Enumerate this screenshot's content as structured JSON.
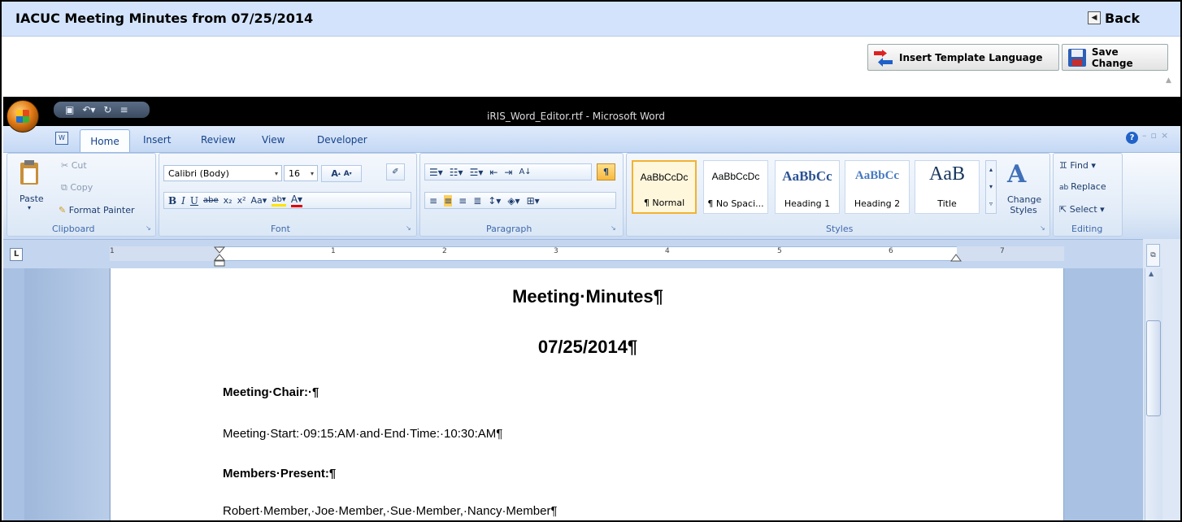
{
  "header": {
    "title": "IACUC Meeting Minutes from 07/25/2014",
    "back_label": "Back"
  },
  "toolbar": {
    "insert_template_label": "Insert Template Language",
    "save_label": "Save Change"
  },
  "word": {
    "window_title": "iRIS_Word_Editor.rtf - Microsoft Word",
    "tabs": [
      "Home",
      "Insert",
      "Review",
      "View",
      "Developer"
    ],
    "clipboard": {
      "paste": "Paste",
      "cut": "Cut",
      "copy": "Copy",
      "format_painter": "Format Painter",
      "group_label": "Clipboard"
    },
    "font": {
      "name": "Calibri (Body)",
      "size": "16",
      "group_label": "Font"
    },
    "paragraph": {
      "group_label": "Paragraph"
    },
    "styles": {
      "group_label": "Styles",
      "items": [
        {
          "sample": "AaBbCcDc",
          "name": "¶ Normal"
        },
        {
          "sample": "AaBbCcDc",
          "name": "¶ No Spaci..."
        },
        {
          "sample": "AaBbCc",
          "name": "Heading 1"
        },
        {
          "sample": "AaBbCc",
          "name": "Heading 2"
        },
        {
          "sample": "AaB",
          "name": "Title"
        }
      ],
      "change_styles": "Change Styles"
    },
    "editing": {
      "find": "Find",
      "replace": "Replace",
      "select": "Select",
      "group_label": "Editing"
    },
    "ruler_numbers": [
      "1",
      "1",
      "2",
      "3",
      "4",
      "5",
      "6",
      "7"
    ]
  },
  "document": {
    "title": "Meeting·Minutes¶",
    "date": "07/25/2014¶",
    "chair_label": "Meeting·Chair:·¶",
    "times": "Meeting·Start:·09:15:AM·and·End·Time:·10:30:AM¶",
    "members_label": "Members·Present:¶",
    "members": "Robert·Member,·Joe·Member,·Sue·Member,·Nancy·Member¶"
  }
}
